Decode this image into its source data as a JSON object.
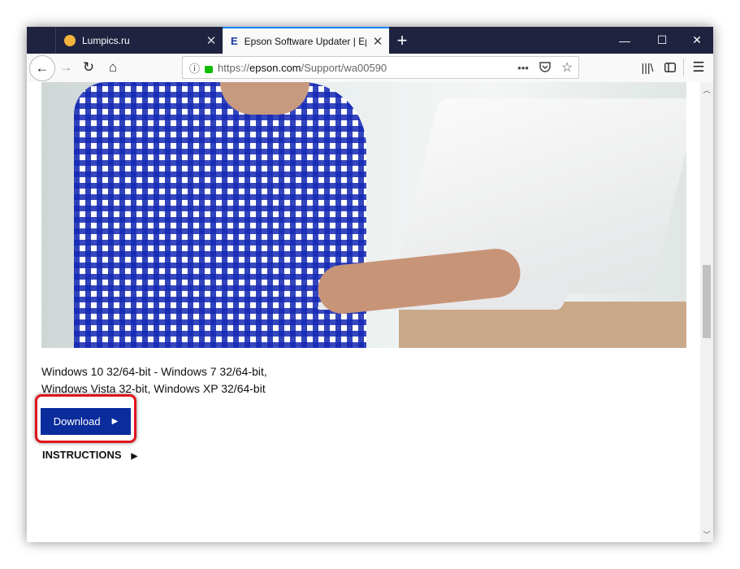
{
  "browser": {
    "tabs": [
      {
        "title": "Lumpics.ru",
        "favicon": "orange-circle-icon",
        "active": false
      },
      {
        "title": "Epson Software Updater | Epso",
        "favicon": "epson-e-icon",
        "favicon_text": "E",
        "active": true
      }
    ],
    "url_prefix": "https://",
    "url_host": "epson.com",
    "url_path": "/Support/wa00590",
    "accent": "#0a84ff",
    "tabbar_color": "#1f2340"
  },
  "page": {
    "os_line1": "Windows 10 32/64-bit - Windows 7 32/64-bit,",
    "os_line2": "Windows Vista 32-bit, Windows XP 32/64-bit",
    "download_label": "Download",
    "download_color": "#0a2c9c",
    "highlight_color": "#e0141e",
    "instructions_label": "INSTRUCTIONS"
  }
}
